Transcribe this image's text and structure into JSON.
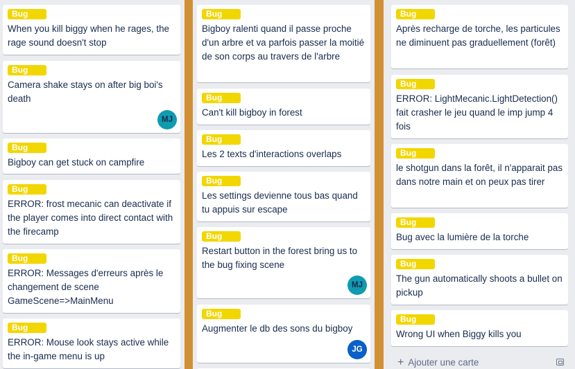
{
  "label_text": "Bug",
  "label_color": "#f2d600",
  "columns": [
    {
      "cards": [
        {
          "title": "When you kill biggy when he rages, the rage sound doesn't stop"
        },
        {
          "title": "Camera shake stays on after big boi's death",
          "member": "MJ"
        },
        {
          "title": "Bigboy can get stuck on campfire"
        },
        {
          "title": "ERROR: frost mecanic can deactivate if the player comes into direct contact with the firecamp"
        },
        {
          "title": "ERROR: Messages d'erreurs après le changement de scene GameScene=>MainMenu"
        },
        {
          "title": "ERROR: Mouse look stays active while the in-game menu is up"
        }
      ]
    },
    {
      "cards": [
        {
          "title": "Bigboy ralenti quand il passe proche d'un arbre et va parfois passer la moitié de son corps au travers de l'arbre"
        },
        {
          "title": "Can't kill bigboy in forest"
        },
        {
          "title": "Les 2 texts d'interactions overlaps"
        },
        {
          "title": "Les settings devienne tous bas quand tu appuis sur escape"
        },
        {
          "title": "Restart button in the forest bring us to the bug fixing scene",
          "member": "MJ"
        },
        {
          "title": "Augmenter le db des sons du bigboy",
          "member": "JG"
        }
      ]
    },
    {
      "cards": [
        {
          "title": "Après recharge de torche, les particules ne diminuent pas graduellement (forêt)"
        },
        {
          "title": "ERROR: LightMecanic.LightDetection() fait crasher le jeu quand le imp jump 4 fois"
        },
        {
          "title": "le shotgun dans la forêt, il n'apparait pas dans notre main et on peux pas tirer"
        },
        {
          "title": "Bug avec la lumière de la torche"
        },
        {
          "title": "The gun automatically shoots a bullet on pickup"
        },
        {
          "title": "Wrong UI when Biggy kills you"
        }
      ],
      "add_card": "Ajouter une carte"
    }
  ]
}
